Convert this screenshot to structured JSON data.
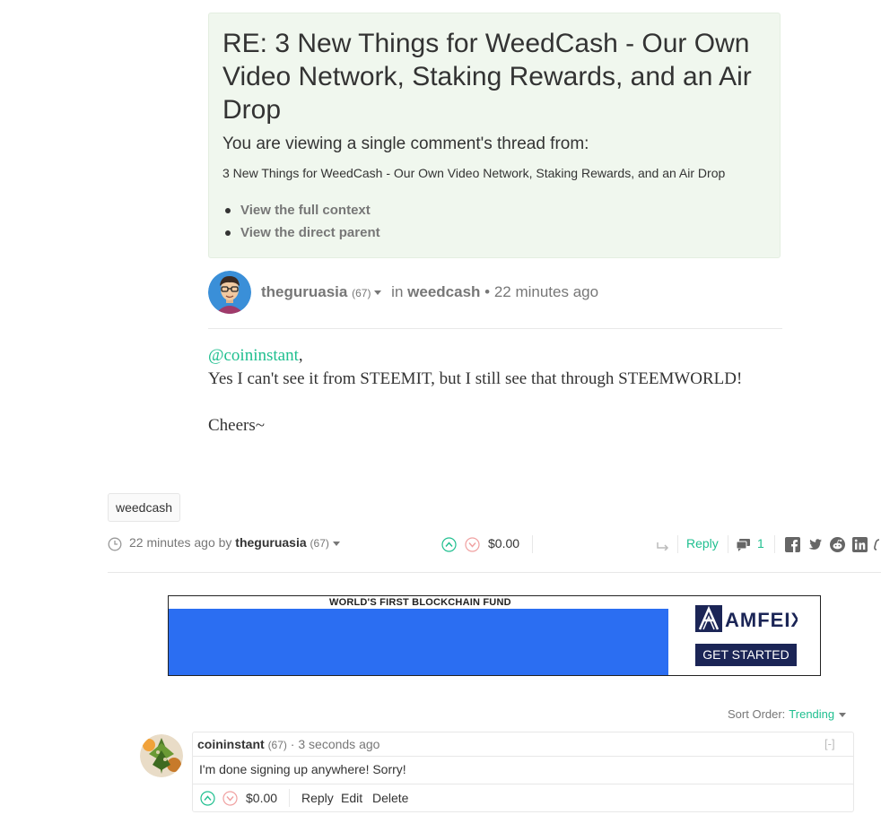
{
  "thread": {
    "title": "RE: 3 New Things for WeedCash - Our Own Video Network, Staking Rewards, and an Air Drop",
    "subtitle": "You are viewing a single comment's thread from:",
    "parent_post": "3 New Things for WeedCash - Our Own Video Network, Staking Rewards, and an Air Drop",
    "links": [
      "View the full context",
      "View the direct parent"
    ]
  },
  "comment": {
    "author": "theguruasia",
    "reputation": "(67)",
    "in_label": "in",
    "community": "weedcash",
    "time": "22 minutes ago",
    "mention": "@coininstant",
    "mention_suffix": ",",
    "line1": "Yes I can't see it from STEEMIT, but I still see that through STEEMWORLD!",
    "line2": "Cheers~"
  },
  "tag": "weedcash",
  "footer": {
    "time_by": "22 minutes ago by",
    "author": "theguruasia",
    "reputation": "(67)",
    "payout": "$0.00",
    "reply_label": "Reply",
    "comment_count": "1"
  },
  "ad": {
    "headline": "WORLD'S FIRST BLOCKCHAIN FUND",
    "brand": "AMFEIX",
    "cta": "GET STARTED",
    "colors": {
      "banner": "#2b6ef2",
      "cta_bg": "#1b2556"
    }
  },
  "sort": {
    "label": "Sort Order:",
    "value": "Trending"
  },
  "reply": {
    "author": "coininstant",
    "reputation": "(67)",
    "dot": "·",
    "time": "3 seconds ago",
    "collapse": "[-]",
    "text": "I'm done signing up anywhere! Sorry!",
    "payout": "$0.00",
    "actions": [
      "Reply",
      "Edit",
      "Delete"
    ]
  },
  "theme": {
    "accent": "#1fbf8f",
    "thread_bg": "#f0f7ee",
    "muted": "#777777"
  },
  "icons": [
    "clock-icon",
    "upvote-icon",
    "downvote-icon",
    "resteem-icon",
    "comments-icon",
    "facebook-icon",
    "twitter-icon",
    "reddit-icon",
    "linkedin-icon",
    "link-icon",
    "avatar",
    "caret-down-icon"
  ]
}
